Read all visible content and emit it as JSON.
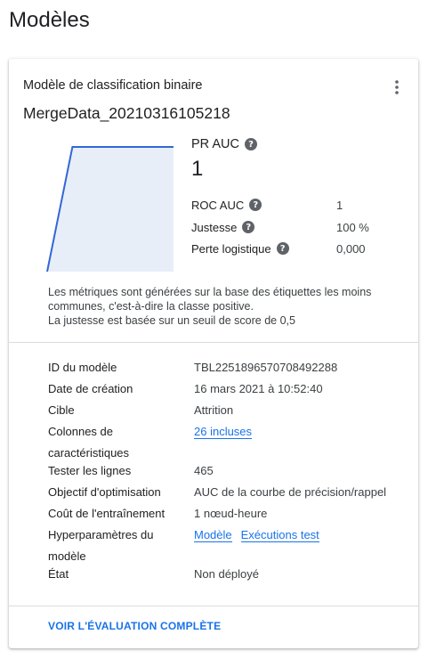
{
  "page": {
    "title": "Modèles"
  },
  "card": {
    "subtitle": "Modèle de classification binaire",
    "model_name": "MergeData_20210316105218",
    "more_icon": "more-vert-icon"
  },
  "metrics": {
    "primary": {
      "label": "PR AUC",
      "value": "1"
    },
    "rows": [
      {
        "label": "ROC AUC",
        "value": "1"
      },
      {
        "label": "Justesse",
        "value": "100 %"
      },
      {
        "label": "Perte logistique",
        "value": "0,000"
      }
    ]
  },
  "chart_data": {
    "type": "area",
    "x": [
      0,
      0.2,
      1,
      1
    ],
    "y": [
      0,
      1,
      1,
      0
    ],
    "xlim": [
      0,
      1
    ],
    "ylim": [
      0,
      1
    ],
    "colors": {
      "line": "#3367d6",
      "fill": "#e8eef8"
    }
  },
  "note": {
    "line1": "Les métriques sont générées sur la base des étiquettes les moins communes, c'est-à-dire la classe positive.",
    "line2": "La justesse est basée sur un seuil de score de 0,5"
  },
  "details": {
    "model_id_label": "ID du modèle",
    "model_id_value": "TBL2251896570708492288",
    "created_label": "Date de création",
    "created_value": "16 mars 2021 à 10:52:40",
    "target_label": "Cible",
    "target_value": "Attrition",
    "features_label": "Colonnes de caractéristiques",
    "features_value": "26 incluses",
    "test_rows_label": "Tester les lignes",
    "test_rows_value": "465",
    "objective_label": "Objectif d'optimisation",
    "objective_value": "AUC de la courbe de précision/rappel",
    "cost_label": "Coût de l'entraînement",
    "cost_value": "1 nœud-heure",
    "hyper_label": "Hyperparamètres du modèle",
    "hyper_link1": "Modèle",
    "hyper_link2": "Exécutions test",
    "state_label": "État",
    "state_value": "Non déployé"
  },
  "footer": {
    "button_label": "VOIR L'ÉVALUATION COMPLÈTE"
  },
  "colors": {
    "accent": "#1a73e8",
    "divider": "#dadce0",
    "text": "#202124",
    "muted": "#3c4043"
  }
}
